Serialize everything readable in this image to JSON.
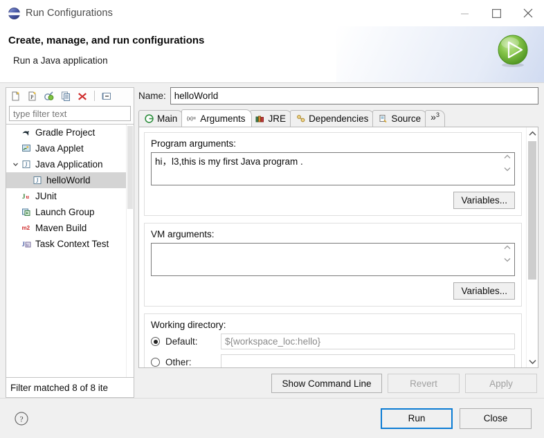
{
  "window": {
    "title": "Run Configurations",
    "icon": "eclipse-icon",
    "controls": [
      {
        "name": "minimize-button",
        "glyph": "minimize-icon"
      },
      {
        "name": "maximize-button",
        "glyph": "maximize-icon"
      },
      {
        "name": "close-button",
        "glyph": "close-icon"
      }
    ]
  },
  "banner": {
    "title": "Create, manage, and run configurations",
    "subtitle": "Run a Java application",
    "badge_icon": "run-play-icon"
  },
  "left_panel": {
    "toolbar": [
      {
        "name": "new-configuration-button",
        "icon": "new-launch-configuration-icon"
      },
      {
        "name": "new-prototype-button",
        "icon": "new-prototype-icon"
      },
      {
        "name": "export-button",
        "icon": "export-configuration-icon"
      },
      {
        "name": "duplicate-button",
        "icon": "duplicate-icon"
      },
      {
        "name": "delete-button",
        "icon": "delete-red-x-icon"
      },
      {
        "name": "collapse-all-button",
        "icon": "collapse-all-icon"
      }
    ],
    "filter": {
      "value": "",
      "placeholder": "type filter text"
    },
    "tree": [
      {
        "label": "Gradle Project",
        "icon": "gradle-icon",
        "depth": 0,
        "expander": "none",
        "selected": false
      },
      {
        "label": "Java Applet",
        "icon": "java-applet-icon",
        "depth": 0,
        "expander": "none",
        "selected": false
      },
      {
        "label": "Java Application",
        "icon": "java-app-icon",
        "depth": 0,
        "expander": "expanded",
        "selected": false
      },
      {
        "label": "helloWorld",
        "icon": "java-app-icon",
        "depth": 1,
        "expander": "none",
        "selected": true
      },
      {
        "label": "JUnit",
        "icon": "junit-icon",
        "depth": 0,
        "expander": "none",
        "selected": false
      },
      {
        "label": "Launch Group",
        "icon": "launch-group-icon",
        "depth": 0,
        "expander": "none",
        "selected": false
      },
      {
        "label": "Maven Build",
        "icon": "maven-m2-icon",
        "depth": 0,
        "expander": "none",
        "selected": false
      },
      {
        "label": "Task Context Test",
        "icon": "task-context-icon",
        "depth": 0,
        "expander": "none",
        "selected": false
      }
    ],
    "status": "Filter matched 8 of 8 ite"
  },
  "config": {
    "name_label": "Name:",
    "name_value": "helloWorld",
    "tabs": [
      {
        "label": "Main",
        "icon": "main-green-g-icon",
        "active": false
      },
      {
        "label": "Arguments",
        "icon": "arguments-xeq-icon",
        "active": true
      },
      {
        "label": "JRE",
        "icon": "jre-books-icon",
        "active": false
      },
      {
        "label": "Dependencies",
        "icon": "dependencies-icon",
        "active": false
      },
      {
        "label": "Source",
        "icon": "source-icon",
        "active": false
      }
    ],
    "tab_overflow": {
      "glyph": "»",
      "count": "3"
    },
    "program_arguments": {
      "label": "Program arguments:",
      "value": "hi，l3,this is my first Java program .",
      "variables_button": "Variables..."
    },
    "vm_arguments": {
      "label": "VM arguments:",
      "value": "",
      "variables_button": "Variables..."
    },
    "working_directory": {
      "label": "Working directory:",
      "default_label": "Default:",
      "default_value": "${workspace_loc:hello}",
      "default_selected": true,
      "other_label": "Other:",
      "other_value": "",
      "other_selected": false
    },
    "actions": {
      "show_command_line": "Show Command Line",
      "revert": "Revert",
      "revert_enabled": false,
      "apply": "Apply",
      "apply_enabled": false
    }
  },
  "footer": {
    "help_icon": "help-question-icon",
    "run_button": "Run",
    "close_button": "Close"
  },
  "colors": {
    "accent_blue": "#0a7bd4",
    "run_green": "#6fbf3f",
    "delete_red": "#cf2c2c",
    "selection_gray": "#d4d4d4"
  }
}
